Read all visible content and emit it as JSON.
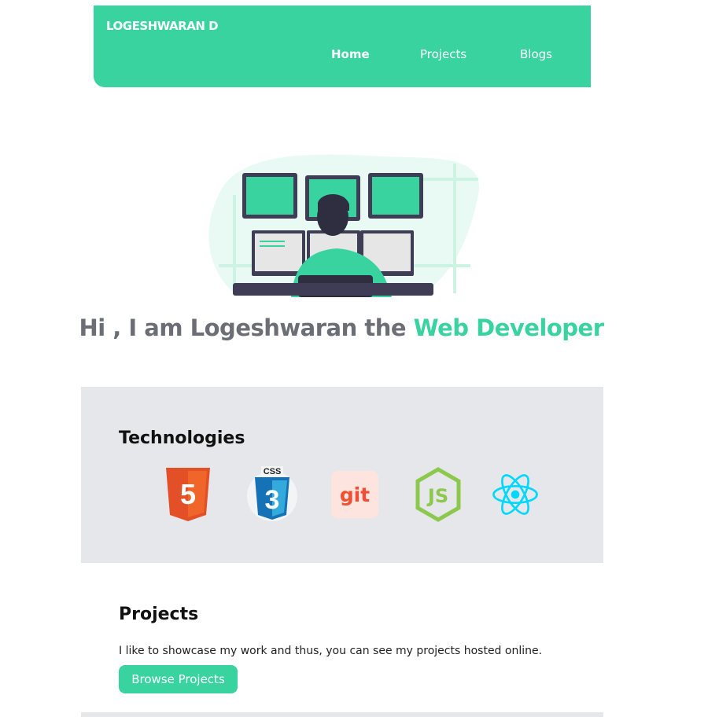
{
  "theme": {
    "accent": "#38d39f",
    "text_gray": "#6b6f75",
    "section_gray": "#e5e7eb"
  },
  "navbar": {
    "brand": "LOGESHWARAN D",
    "links": [
      {
        "label": "Home",
        "active": true
      },
      {
        "label": "Projects",
        "active": false
      },
      {
        "label": "Blogs",
        "active": false
      }
    ]
  },
  "hero": {
    "title_prefix": "Hi , I am Logeshwaran the ",
    "title_accent": "Web Developer",
    "illustration": "developer-at-monitors-illustration"
  },
  "technologies": {
    "heading": "Technologies",
    "icons": [
      {
        "name": "html5-icon",
        "label": "5",
        "color": "#e34f26"
      },
      {
        "name": "css3-icon",
        "label": "CSS",
        "color": "#1572b6"
      },
      {
        "name": "git-icon",
        "label": "git",
        "color": "#f05032"
      },
      {
        "name": "nodejs-icon",
        "label": "JS",
        "color": "#8cc84b"
      },
      {
        "name": "react-icon",
        "label": "",
        "color": "#00d8ff"
      }
    ]
  },
  "projects": {
    "heading": "Projects",
    "description": "I like to showcase my work and thus, you can see my projects hosted online.",
    "button_label": "Browse Projects"
  }
}
